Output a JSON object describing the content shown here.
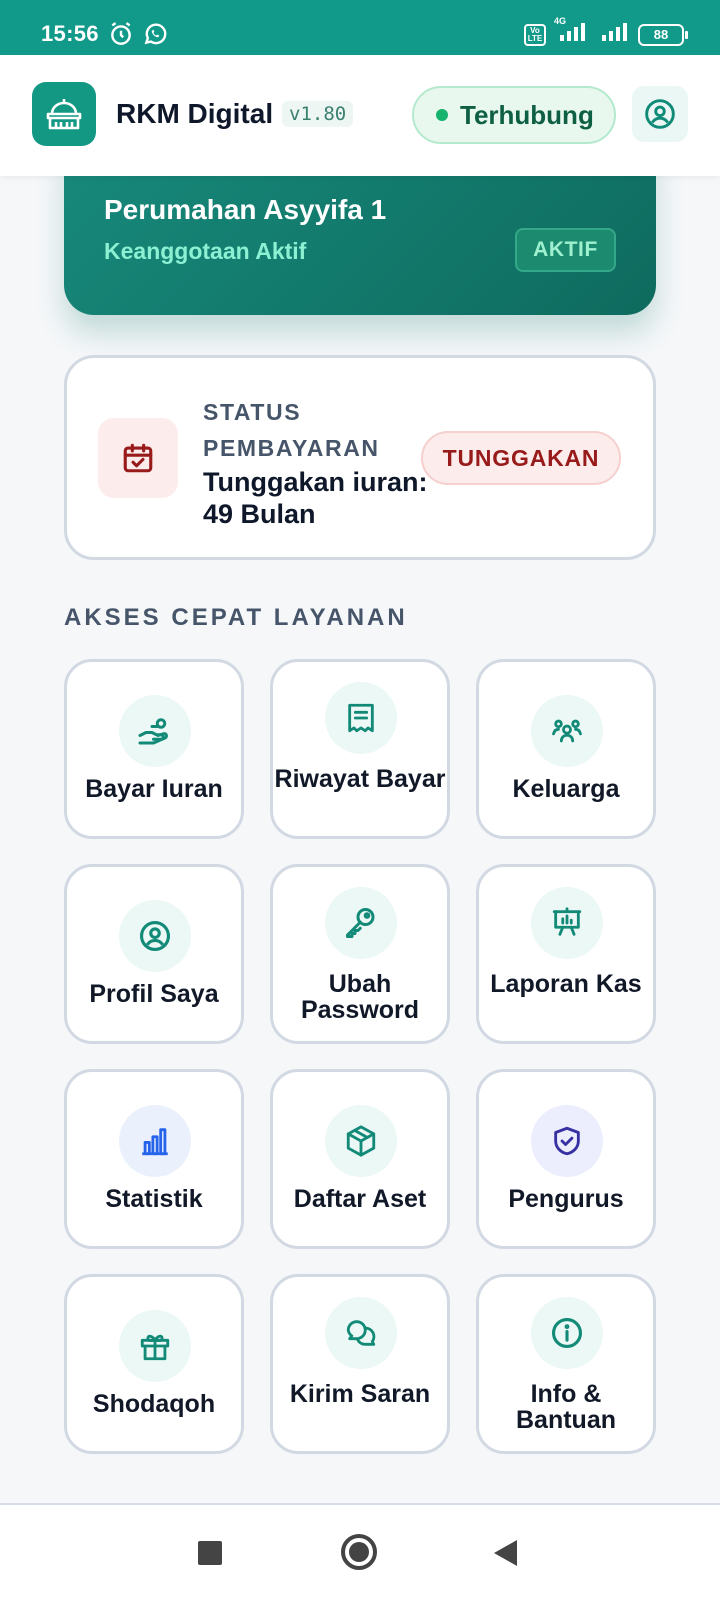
{
  "status_bar": {
    "time": "15:56",
    "battery": "88",
    "network_label": "4G",
    "volte_label": "Vo LTE"
  },
  "header": {
    "app_title": "RKM Digital",
    "version": "v1.80",
    "connection_status": "Terhubung"
  },
  "membership": {
    "name": "Perumahan Asyyifa 1",
    "subtitle": "Keanggotaan Aktif",
    "badge": "AKTIF"
  },
  "payment": {
    "label": "STATUS PEMBAYARAN",
    "value": "Tunggakan iuran: 49 Bulan",
    "badge": "TUNGGAKAN"
  },
  "section_title": "AKSES CEPAT LAYANAN",
  "menu": [
    {
      "label": "Bayar Iuran",
      "icon": "hand-coin-icon"
    },
    {
      "label": "Riwayat Bayar",
      "icon": "receipt-icon"
    },
    {
      "label": "Keluarga",
      "icon": "family-icon"
    },
    {
      "label": "Profil Saya",
      "icon": "user-circle-icon"
    },
    {
      "label": "Ubah Password",
      "icon": "key-icon"
    },
    {
      "label": "Laporan Kas",
      "icon": "presentation-chart-icon"
    },
    {
      "label": "Statistik",
      "icon": "bar-chart-icon"
    },
    {
      "label": "Daftar Aset",
      "icon": "box-icon"
    },
    {
      "label": "Pengurus",
      "icon": "shield-check-icon"
    },
    {
      "label": "Shodaqoh",
      "icon": "gift-icon"
    },
    {
      "label": "Kirim Saran",
      "icon": "chat-bubbles-icon"
    },
    {
      "label": "Info & Bantuan",
      "icon": "info-circle-icon"
    }
  ],
  "colors": {
    "status_bar": "#119a8a",
    "brand": "#139884",
    "accent_icon": "#138a78",
    "danger": "#981b1b",
    "connected": "#15b36d"
  }
}
